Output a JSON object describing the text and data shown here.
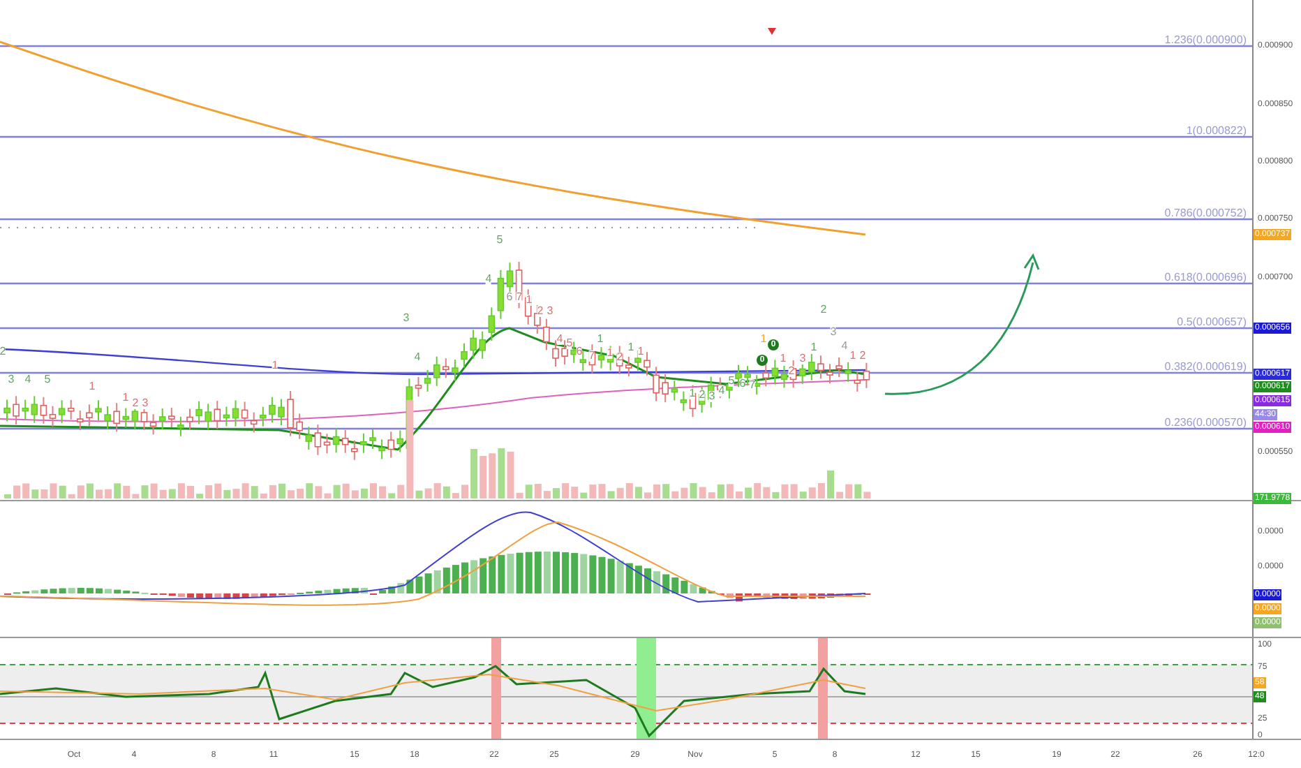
{
  "main_pane": {
    "fib_levels": [
      {
        "label": "1.236(0.000900)"
      },
      {
        "label": "1(0.000822)"
      },
      {
        "label": "0.786(0.000752)"
      },
      {
        "label": "0.618(0.000696)"
      },
      {
        "label": "0.5(0.000657)"
      },
      {
        "label": "0.382(0.000619)"
      },
      {
        "label": "0.236(0.000570)"
      }
    ],
    "price_axis": [
      "0.000900",
      "0.000850",
      "0.000800",
      "0.000750",
      "0.000700",
      "0.000550"
    ],
    "price_badges": [
      {
        "text": "0.000737",
        "color": "#f5a623"
      },
      {
        "text": "0.000656",
        "color": "#1a1ad6"
      },
      {
        "text": "0.000617",
        "color": "#2a2ad6"
      },
      {
        "text": "0.000617",
        "color": "#1e8c1e"
      },
      {
        "text": "0.000615",
        "color": "#8a2be2"
      },
      {
        "text": "44:30",
        "color": "#9a8ae6"
      },
      {
        "text": "0.000610",
        "color": "#e020c0"
      },
      {
        "text": "171.9778",
        "color": "#3cb83c"
      }
    ],
    "td_counts": [
      {
        "text": "2",
        "color": "#5fa85f",
        "kind": "plain"
      },
      {
        "text": "3",
        "color": "#5fa85f",
        "kind": "plain"
      },
      {
        "text": "4",
        "color": "#5fa85f",
        "kind": "plain"
      },
      {
        "text": "5",
        "color": "#5fa85f",
        "kind": "plain"
      },
      {
        "text": "1",
        "color": "#e07070",
        "kind": "plain"
      },
      {
        "text": "1",
        "color": "#e07070",
        "kind": "plain"
      },
      {
        "text": "2",
        "color": "#e07070",
        "kind": "plain"
      },
      {
        "text": "3",
        "color": "#e07070",
        "kind": "plain"
      },
      {
        "text": "1",
        "color": "#e07070",
        "kind": "plain"
      },
      {
        "text": "3",
        "color": "#5fa85f",
        "kind": "plain"
      },
      {
        "text": "4",
        "color": "#5fa85f",
        "kind": "plain"
      },
      {
        "text": "4",
        "color": "#5fa85f",
        "kind": "plain"
      },
      {
        "text": "5",
        "color": "#5fa85f",
        "kind": "plain"
      },
      {
        "text": "6",
        "color": "#999999",
        "kind": "plain"
      },
      {
        "text": "7",
        "color": "#e07070",
        "kind": "plain"
      },
      {
        "text": "1",
        "color": "#e07070",
        "kind": "plain"
      },
      {
        "text": "2",
        "color": "#e07070",
        "kind": "plain"
      },
      {
        "text": "3",
        "color": "#e07070",
        "kind": "plain"
      },
      {
        "text": "4",
        "color": "#e07070",
        "kind": "plain"
      },
      {
        "text": "5",
        "color": "#e07070",
        "kind": "plain"
      },
      {
        "text": "6",
        "color": "#e07070",
        "kind": "plain"
      },
      {
        "text": "7",
        "color": "#e07070",
        "kind": "plain"
      },
      {
        "text": "1",
        "color": "#5fa85f",
        "kind": "plain"
      },
      {
        "text": "1",
        "color": "#e07070",
        "kind": "plain"
      },
      {
        "text": "2",
        "color": "#e07070",
        "kind": "plain"
      },
      {
        "text": "1",
        "color": "#5fa85f",
        "kind": "plain"
      },
      {
        "text": "1",
        "color": "#e07070",
        "kind": "plain"
      },
      {
        "text": "1",
        "color": "#5fa85f",
        "kind": "plain"
      },
      {
        "text": "2",
        "color": "#5fa85f",
        "kind": "plain"
      },
      {
        "text": "3",
        "color": "#5fa85f",
        "kind": "plain"
      },
      {
        "text": "4",
        "color": "#5fa85f",
        "kind": "plain"
      },
      {
        "text": "5",
        "color": "#5fa85f",
        "kind": "plain"
      },
      {
        "text": "6",
        "color": "#5fa85f",
        "kind": "plain"
      },
      {
        "text": "7",
        "color": "#5fa85f",
        "kind": "plain"
      },
      {
        "text": "1",
        "color": "#f5a623",
        "kind": "plain"
      },
      {
        "text": "0",
        "color": "#1e7a1e",
        "kind": "circle"
      },
      {
        "text": "0",
        "color": "#1e7a1e",
        "kind": "circle"
      },
      {
        "text": "1",
        "color": "#e07070",
        "kind": "plain"
      },
      {
        "text": "2",
        "color": "#e07070",
        "kind": "plain"
      },
      {
        "text": "3",
        "color": "#e07070",
        "kind": "plain"
      },
      {
        "text": "1",
        "color": "#5fa85f",
        "kind": "plain"
      },
      {
        "text": "2",
        "color": "#5fa85f",
        "kind": "plain"
      },
      {
        "text": "3",
        "color": "#999999",
        "kind": "plain"
      },
      {
        "text": "4",
        "color": "#999999",
        "kind": "plain"
      },
      {
        "text": "1",
        "color": "#e07070",
        "kind": "plain"
      },
      {
        "text": "2",
        "color": "#e07070",
        "kind": "plain"
      }
    ]
  },
  "macd_pane": {
    "axis": [
      "0.0000",
      "0.0000"
    ],
    "badges": [
      {
        "text": "0.0000",
        "color": "#1a1ad6"
      },
      {
        "text": "0.0000",
        "color": "#f5a623"
      },
      {
        "text": "0.0000",
        "color": "#8fbf6f"
      }
    ]
  },
  "rsi_pane": {
    "axis": [
      "100",
      "75",
      "25",
      "0"
    ],
    "badges": [
      {
        "text": "58",
        "color": "#f5a623"
      },
      {
        "text": "48",
        "color": "#1e8c1e"
      }
    ]
  },
  "time_axis": [
    "Oct",
    "4",
    "8",
    "11",
    "15",
    "18",
    "22",
    "25",
    "29",
    "Nov",
    "5",
    "8",
    "12",
    "15",
    "19",
    "22",
    "26",
    "12:0"
  ]
}
